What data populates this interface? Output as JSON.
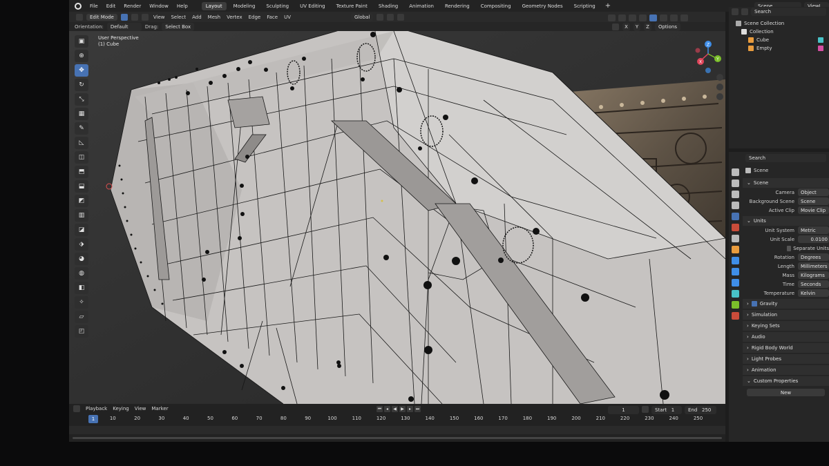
{
  "menubar": {
    "items": [
      "File",
      "Edit",
      "Render",
      "Window",
      "Help"
    ],
    "workspaces": [
      "Layout",
      "Modeling",
      "Sculpting",
      "UV Editing",
      "Texture Paint",
      "Shading",
      "Animation",
      "Rendering",
      "Compositing",
      "Geometry Nodes",
      "Scripting"
    ],
    "active_workspace": "Layout",
    "add_tab": "+",
    "scene_name": "Scene",
    "view_layer": "ViewL"
  },
  "viewport_header": {
    "mode": "Edit Mode",
    "menus": [
      "View",
      "Select",
      "Add",
      "Mesh",
      "Vertex",
      "Edge",
      "Face",
      "UV"
    ],
    "transform_orientation": "Global"
  },
  "tool_settings": {
    "orientation_label": "Orientation:",
    "orientation_value": "Default",
    "drag_label": "Drag:",
    "drag_value": "Select Box",
    "options_label": "Options",
    "mirror_axes": [
      "X",
      "Y",
      "Z"
    ]
  },
  "viewport": {
    "view_name": "User Perspective",
    "object_name": "(1) Cube",
    "gizmo_axes": [
      "X",
      "Y",
      "Z"
    ]
  },
  "toolbar_icons": [
    "select-box-icon",
    "cursor-icon",
    "move-icon",
    "rotate-icon",
    "scale-icon",
    "transform-icon",
    "annotate-icon",
    "measure-icon",
    "add-cube-icon",
    "extrude-icon",
    "inset-icon",
    "bevel-icon",
    "loop-cut-icon",
    "knife-icon",
    "poly-build-icon",
    "spin-icon",
    "smooth-icon",
    "edge-slide-icon",
    "shrink-fatten-icon",
    "shear-icon",
    "rip-icon"
  ],
  "outliner": {
    "search_placeholder": "Search",
    "root": "Scene Collection",
    "collection": "Collection",
    "objects": [
      "Cube",
      "Empty"
    ]
  },
  "properties": {
    "search_placeholder": "Search",
    "context_title": "Scene",
    "scene_panel": "Scene",
    "camera_label": "Camera",
    "camera_value": "Object",
    "background_scene_label": "Background Scene",
    "background_scene_value": "Scene",
    "active_clip_label": "Active Clip",
    "active_clip_value": "Movie Clip",
    "units_panel": "Units",
    "units": [
      {
        "label": "Unit System",
        "value": "Metric"
      },
      {
        "label": "Unit Scale",
        "value": "0.0100"
      }
    ],
    "separate_units_label": "Separate Units",
    "units2": [
      {
        "label": "Rotation",
        "value": "Degrees"
      },
      {
        "label": "Length",
        "value": "Millimeters"
      },
      {
        "label": "Mass",
        "value": "Kilograms"
      },
      {
        "label": "Time",
        "value": "Seconds"
      },
      {
        "label": "Temperature",
        "value": "Kelvin"
      }
    ],
    "collapsed_panels": [
      "Gravity",
      "Simulation",
      "Keying Sets",
      "Audio",
      "Rigid Body World",
      "Light Probes",
      "Animation"
    ],
    "custom_props_panel": "Custom Properties",
    "new_button": "New"
  },
  "timeline": {
    "menus": [
      "Playback",
      "Keying",
      "View",
      "Marker"
    ],
    "current_frame": "1",
    "current_frame_field": "1",
    "start_label": "Start",
    "start_value": "1",
    "end_label": "End",
    "end_value": "250",
    "ticks": [
      "10",
      "20",
      "30",
      "40",
      "50",
      "60",
      "70",
      "80",
      "90",
      "100",
      "110",
      "120",
      "130",
      "140",
      "150",
      "160",
      "170",
      "180",
      "190",
      "200",
      "210",
      "220",
      "230",
      "240",
      "250"
    ]
  },
  "colors": {
    "accent": "#4772b3",
    "mesh_face": "#c9c6c4",
    "wire": "#141414",
    "axis_x": "#e0455a",
    "axis_y": "#7bbf2a",
    "axis_z": "#3f8ee8"
  }
}
